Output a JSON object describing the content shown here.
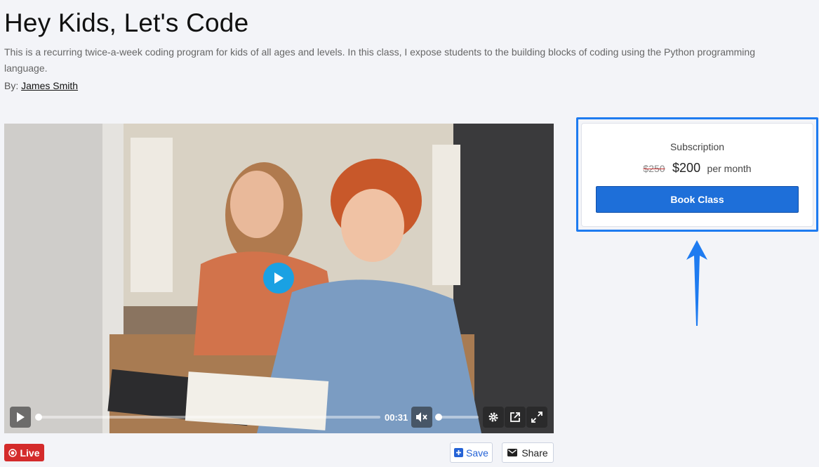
{
  "page": {
    "title": "Hey Kids, Let's Code",
    "description": "This is a recurring twice-a-week coding program for kids of all ages and levels. In this class, I expose students to the building blocks of coding using the Python programming language.",
    "by_label": "By:",
    "author": "James Smith"
  },
  "video": {
    "time": "00:31",
    "progress_fraction": 0.0,
    "volume_fraction": 0.0,
    "icons": [
      "play-icon",
      "mute-icon",
      "settings-icon",
      "popout-icon",
      "fullscreen-icon"
    ]
  },
  "actions": {
    "live_label": "Live",
    "save_label": "Save",
    "share_label": "Share"
  },
  "subscription": {
    "label": "Subscription",
    "old_price": "$250",
    "new_price": "$200",
    "period": "per month",
    "button_label": "Book Class"
  },
  "colors": {
    "accent": "#1e6fd9",
    "highlight": "#1e7bf0",
    "live": "#d42b2b",
    "play": "#1aa1e3"
  }
}
